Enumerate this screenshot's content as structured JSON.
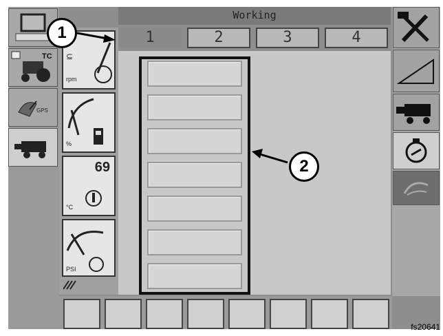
{
  "header": {
    "title": "Working"
  },
  "tabs": [
    {
      "label": "1",
      "active": true
    },
    {
      "label": "2",
      "active": false
    },
    {
      "label": "3",
      "active": false
    },
    {
      "label": "4",
      "active": false
    }
  ],
  "gauges": {
    "engine_temp": {
      "value": "69",
      "unit": "°C"
    },
    "fuel": {
      "unit": "%"
    },
    "oil_pressure": {
      "unit": "PSI"
    },
    "load": {
      "unit": "rpm"
    }
  },
  "callouts": {
    "one": "1",
    "two": "2"
  },
  "figure_label": "fs20641",
  "colors": {
    "frame": "#8e8e8e",
    "work_area": "#c8c8c8",
    "active_tab": "#8a8a8a"
  },
  "icons": {
    "left": [
      "monitor-icon",
      "tractor-icon",
      "gps-satellite-icon",
      "combine-icon"
    ],
    "right": [
      "tools-icon",
      "slope-icon",
      "combine-icon",
      "engine-icon",
      "header-control-icon"
    ]
  }
}
